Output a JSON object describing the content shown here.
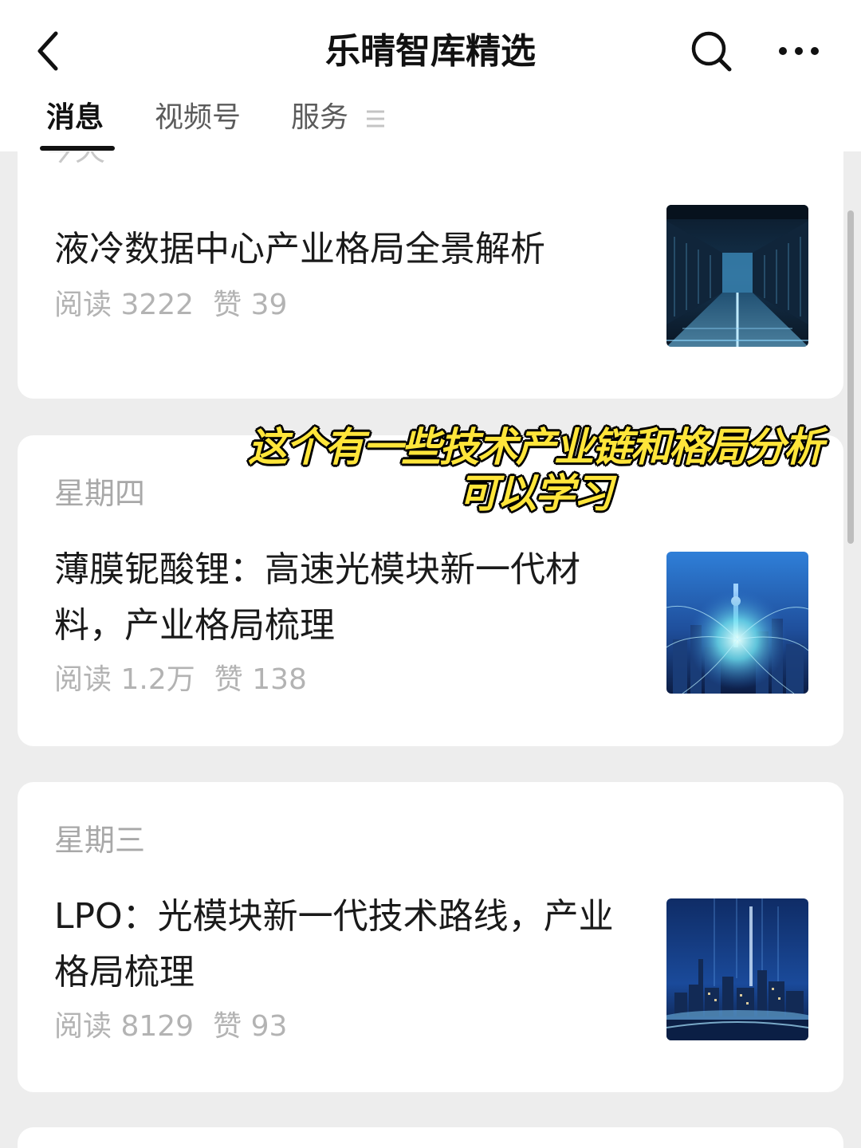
{
  "header": {
    "title": "乐晴智库精选"
  },
  "tabs": [
    {
      "label": "消息"
    },
    {
      "label": "视频号"
    },
    {
      "label": "服务"
    }
  ],
  "partial_day_label": "今天",
  "articles": [
    {
      "day": "",
      "title": "液冷数据中心产业格局全景解析",
      "read_label": "阅读",
      "read_count": "3222",
      "like_label": "赞",
      "like_count": "39",
      "thumb_icon": "data-center-corridor-image"
    },
    {
      "day": "星期四",
      "title": "薄膜铌酸锂：高速光模块新一代材料，产业格局梳理",
      "read_label": "阅读",
      "read_count": "1.2万",
      "like_label": "赞",
      "like_count": "138",
      "thumb_icon": "network-city-image"
    },
    {
      "day": "星期三",
      "title": "LPO：光模块新一代技术路线，产业格局梳理",
      "read_label": "阅读",
      "read_count": "8129",
      "like_label": "赞",
      "like_count": "93",
      "thumb_icon": "city-skyline-image"
    }
  ],
  "overlay_caption": {
    "line1": "这个有一些技术产业链和格局分析",
    "line2": "可以学习"
  },
  "colors": {
    "accent_caption": "#ffe53a",
    "muted_text": "#b3b3b3",
    "background": "#ededed"
  }
}
